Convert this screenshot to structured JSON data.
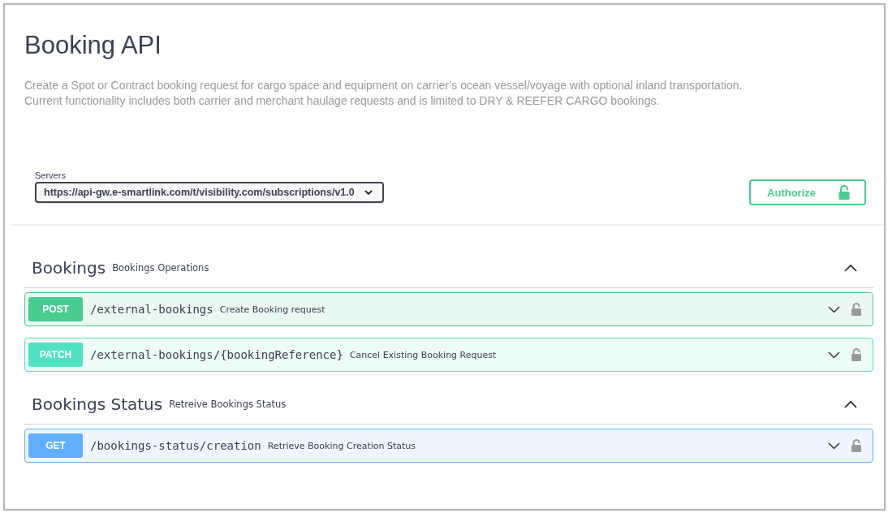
{
  "title": "Booking API",
  "description": [
    "Create a Spot or Contract booking request for cargo space and equipment on carrier’s ocean vessel/voyage with optional inland transportation.",
    "Current functionality includes both carrier and merchant haulage requests and is limited to DRY & REEFER CARGO bookings."
  ],
  "servers": {
    "label": "Servers",
    "value": "https://api-gw.e-smartlink.com/t/visibility.com/subscriptions/v1.0"
  },
  "authorize": {
    "label": "Authorize"
  },
  "sections": [
    {
      "name": "Bookings",
      "description": "Bookings Operations",
      "expanded": true,
      "operations": [
        {
          "method": "POST",
          "path": "/external-bookings",
          "summary": "Create Booking request"
        },
        {
          "method": "PATCH",
          "path": "/external-bookings/{bookingReference}",
          "summary": "Cancel Existing Booking Request"
        }
      ]
    },
    {
      "name": "Bookings Status",
      "description": "Retreive Bookings Status",
      "expanded": true,
      "operations": [
        {
          "method": "GET",
          "path": "/bookings-status/creation",
          "summary": "Retrieve Booking Creation Status"
        }
      ]
    }
  ]
}
